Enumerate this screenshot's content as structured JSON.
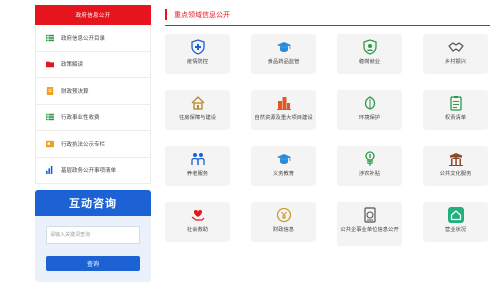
{
  "sidebar": {
    "header": "政府信息公开",
    "items": [
      {
        "label": "政府信息公开目录",
        "icon": "list-icon",
        "color": "#2e9a4a"
      },
      {
        "label": "政策解读",
        "icon": "folder-icon",
        "color": "#e6141d"
      },
      {
        "label": "财政预决算",
        "icon": "document-icon",
        "color": "#f0a020"
      },
      {
        "label": "行政事业性收费",
        "icon": "list-icon",
        "color": "#2e9a4a"
      },
      {
        "label": "行政执法公示专栏",
        "icon": "card-icon",
        "color": "#f0a020"
      },
      {
        "label": "基层政务公开事项清单",
        "icon": "bar-chart-icon",
        "color": "#1c62d4"
      }
    ]
  },
  "consult": {
    "title": "互动咨询",
    "input_placeholder": "请输入关键词查询",
    "button_label": "查询"
  },
  "main": {
    "title": "重点领域信息公开",
    "tiles": [
      {
        "label": "疫情防控",
        "icon": "medical-shield-icon",
        "color": "#1c62d4"
      },
      {
        "label": "食品药品监管",
        "icon": "graduation-cap-icon",
        "color": "#2a8bd8"
      },
      {
        "label": "稳岗就业",
        "icon": "shield-badge-icon",
        "color": "#2e9a4a"
      },
      {
        "label": "乡村振兴",
        "icon": "handshake-icon",
        "color": "#555555"
      },
      {
        "label": "住房保障与建设",
        "icon": "house-icon",
        "color": "#b5862d"
      },
      {
        "label": "自然资源及重大项目建设",
        "icon": "buildings-icon",
        "color": "#e0572a"
      },
      {
        "label": "环境保护",
        "icon": "leaf-icon",
        "color": "#2e9a4a"
      },
      {
        "label": "权责清单",
        "icon": "clipboard-icon",
        "color": "#2e9a4a"
      },
      {
        "label": "养老服务",
        "icon": "elderly-people-icon",
        "color": "#1c62d4"
      },
      {
        "label": "义务教育",
        "icon": "graduation-cap-icon",
        "color": "#2a8bd8"
      },
      {
        "label": "涉农补贴",
        "icon": "wheat-coin-icon",
        "color": "#2e9a4a"
      },
      {
        "label": "公共文化服务",
        "icon": "pavilion-icon",
        "color": "#8a4a2a"
      },
      {
        "label": "社会救助",
        "icon": "heart-hands-icon",
        "color": "#e6141d"
      },
      {
        "label": "财政信息",
        "icon": "coin-icon",
        "color": "#c8a030"
      },
      {
        "label": "公共企事业单位信息公开",
        "icon": "document-seal-icon",
        "color": "#555555"
      },
      {
        "label": "营业状况",
        "icon": "app-house-icon",
        "color": "#22b07d"
      }
    ]
  }
}
